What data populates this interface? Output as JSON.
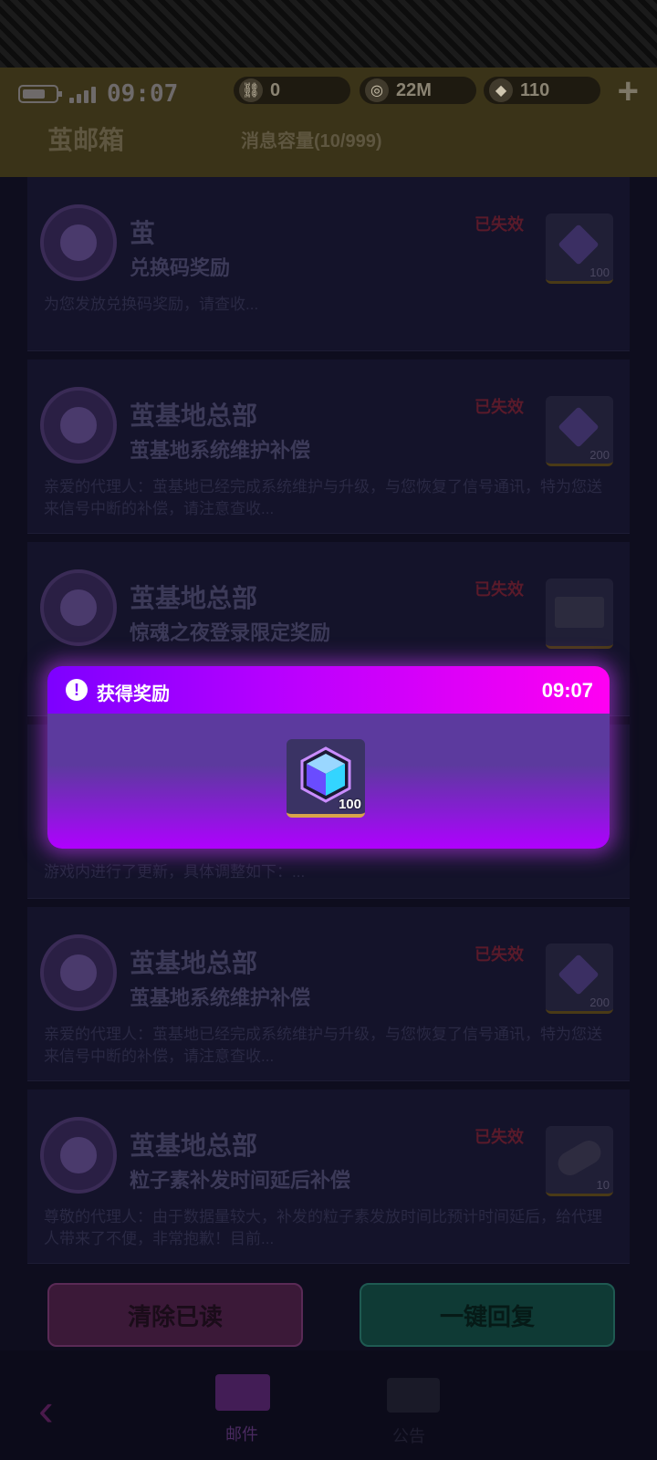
{
  "status_bar": {
    "time": "09:07"
  },
  "currencies": [
    {
      "icon": "link-icon",
      "value": "0"
    },
    {
      "icon": "coin-icon",
      "value": "22M"
    },
    {
      "icon": "cube-icon",
      "value": "110"
    }
  ],
  "header": {
    "title": "茧邮箱",
    "capacity": "消息容量(10/999)"
  },
  "mails": [
    {
      "sender": "茧",
      "subject": "兑换码奖励",
      "status": "已失效",
      "preview": "为您发放兑换码奖励，请查收...",
      "qty": "100"
    },
    {
      "sender": "茧基地总部",
      "subject": "茧基地系统维护补偿",
      "status": "已失效",
      "preview": "亲爱的代理人：茧基地已经完成系统维护与升级，与您恢复了信号通讯，特为您送来信号中断的补偿，请注意查收...",
      "qty": "200"
    },
    {
      "sender": "茧基地总部",
      "subject": "惊魂之夜登录限定奖励",
      "status": "已失效",
      "preview": "",
      "qty": ""
    },
    {
      "sender": "",
      "subject": "",
      "status": "",
      "preview": "游戏内进行了更新，具体调整如下：...",
      "qty": ""
    },
    {
      "sender": "茧基地总部",
      "subject": "茧基地系统维护补偿",
      "status": "已失效",
      "preview": "亲爱的代理人：茧基地已经完成系统维护与升级，与您恢复了信号通讯，特为您送来信号中断的补偿，请注意查收...",
      "qty": "200"
    },
    {
      "sender": "茧基地总部",
      "subject": "粒子素补发时间延后补偿",
      "status": "已失效",
      "preview": "尊敬的代理人：由于数据量较大，补发的粒子素发放时间比预计时间延后，给代理人带来了不便，非常抱歉！目前...",
      "qty": "10"
    }
  ],
  "buttons": {
    "clear_read": "清除已读",
    "reply_all": "一键回复"
  },
  "bottom_nav": {
    "mail_label": "邮件",
    "other_label": "公告"
  },
  "popup": {
    "title": "获得奖励",
    "time": "09:07",
    "reward_qty": "100"
  }
}
